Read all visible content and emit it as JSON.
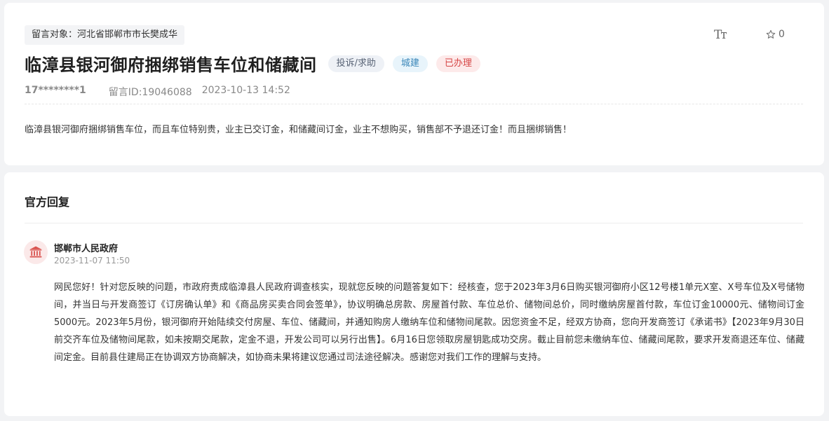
{
  "message": {
    "target_label": "留言对象：河北省邯郸市市长樊成华",
    "font_toggle": "Tт",
    "fav_count": "0",
    "title": "临漳县银河御府捆绑销售车位和储藏间",
    "badges": {
      "type": "投诉/求助",
      "category": "城建",
      "status": "已办理"
    },
    "user": "17********1",
    "message_id": "留言ID:19046088",
    "time": "2023-10-13 14:52",
    "content": "临漳县银河御府捆绑销售车位，而且车位特别贵，业主已交订金，和储藏间订金，业主不想购买，销售部不予退还订金！而且捆绑销售！"
  },
  "reply": {
    "heading": "官方回复",
    "org_name": "邯郸市人民政府",
    "time": "2023-11-07 11:50",
    "text": "网民您好！针对您反映的问题，市政府责成临漳县人民政府调查核实，现就您反映的问题答复如下：经核查，您于2023年3月6日购买银河御府小区12号楼1单元X室、X号车位及X号储物间，并当日与开发商签订《订房确认单》和《商品房买卖合同会签单》，协议明确总房款、房屋首付款、车位总价、储物间总价，同时缴纳房屋首付款，车位订金10000元、储物间订金5000元。2023年5月份，银河御府开始陆续交付房屋、车位、储藏间，并通知购房人缴纳车位和储物间尾款。因您资金不足，经双方协商，您向开发商签订《承诺书》【2023年9月30日前交齐车位及储物间尾款，如未按期交尾款，定金不退，开发公司可以另行出售】。6月16日您领取房屋钥匙成功交房。截止目前您未缴纳车位、储藏间尾款，要求开发商退还车位、储藏间定金。目前县住建局正在协调双方协商解决，如协商未果将建议您通过司法途径解决。感谢您对我们工作的理解与支持。"
  },
  "colors": {
    "status_red": "#d64545",
    "category_blue": "#3a86b8",
    "gov_logo_red": "#d9534f"
  }
}
